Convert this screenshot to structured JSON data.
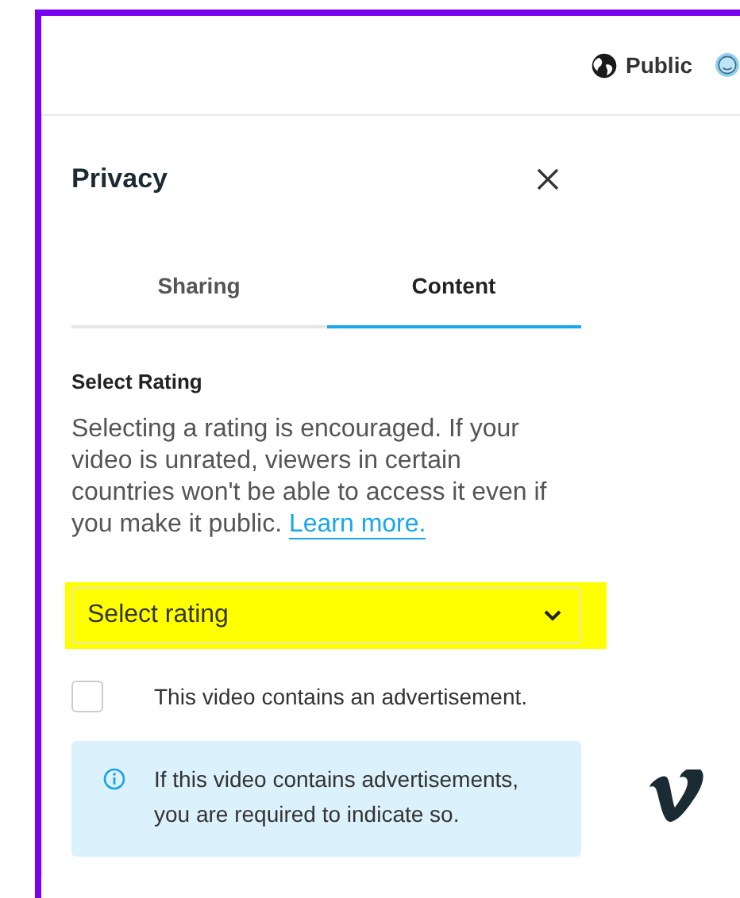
{
  "header": {
    "visibility": {
      "label": "Public"
    }
  },
  "panel": {
    "title": "Privacy",
    "tabs": [
      {
        "label": "Sharing",
        "selected": false
      },
      {
        "label": "Content",
        "selected": true
      }
    ],
    "section_title": "Select Rating",
    "description": "Selecting a rating is encouraged. If your video is unrated, viewers in certain countries won't be able to access it even if you make it public.",
    "link": "Learn more.",
    "rating_select": {
      "placeholder": "Select rating",
      "highlighted": true
    },
    "checkbox": {
      "label": "This video contains an advertisement.",
      "checked": false
    },
    "notice": "If this video contains advertisements, you are required to indicate so."
  }
}
